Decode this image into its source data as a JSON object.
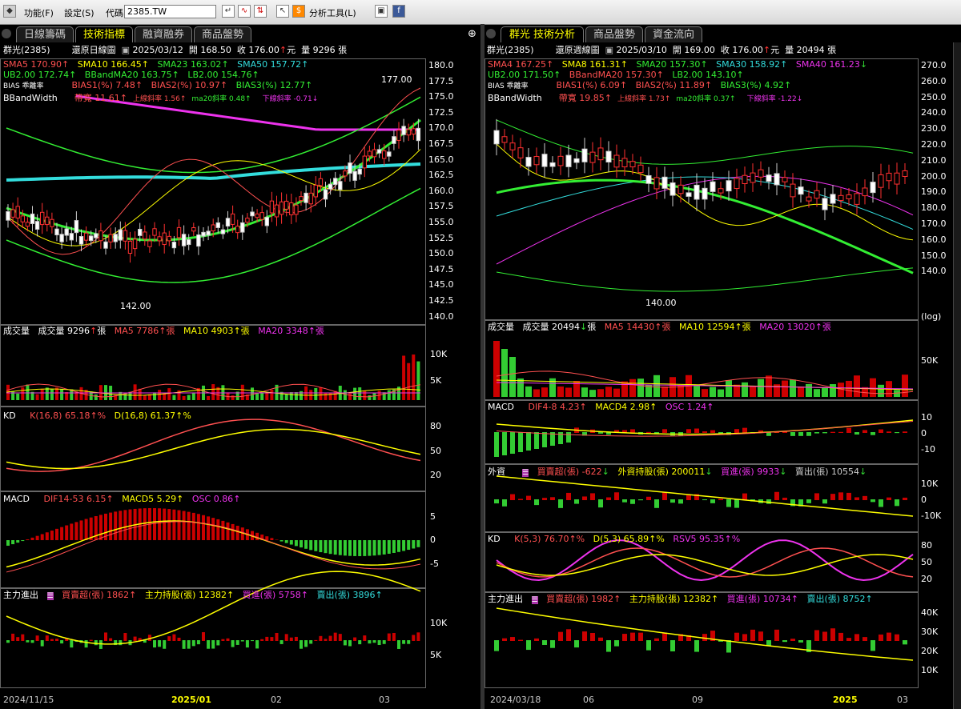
{
  "toolbar": {
    "function": "功能(F)",
    "settings": "設定(S)",
    "code_label": "代碼",
    "code_value": "2385.TW",
    "analysis": "分析工具(L)"
  },
  "left": {
    "tabs": [
      "日線籌碼",
      "技術指標",
      "融資融券",
      "商品盤勢"
    ],
    "name": "群光(2385)",
    "chart_type": "還原日線圖",
    "date": "2025/03/12",
    "open": "開 168.50",
    "close_lbl": "收",
    "close": "176.00",
    "unit": "元",
    "vol_lbl": "量",
    "vol": "9296 張",
    "sma": [
      {
        "t": "SMA5",
        "v": "170.90",
        "c": "#ff5050"
      },
      {
        "t": "SMA10",
        "v": "166.45",
        "c": "#ffff00"
      },
      {
        "t": "SMA23",
        "v": "163.02",
        "c": "#33ee33"
      },
      {
        "t": "SMA50",
        "v": "157.72",
        "c": "#33dddd"
      }
    ],
    "ub": "UB2.00 172.74",
    "bbma": "BBandMA20 163.75",
    "lb": "LB2.00 154.76",
    "bias_lbl": "BIAS 乖離率",
    "bias": [
      "BIAS1(%) 7.48",
      "BIAS2(%) 10.97",
      "BIAS3(%) 12.77"
    ],
    "bbw_lbl": "BBandWidth",
    "bbw": [
      "帶寬 11.61",
      "上線斜率 1.56",
      "ma20斜率 0.48",
      "下線斜率 -0.71"
    ],
    "price_axis": [
      "180.0",
      "177.5",
      "175.0",
      "172.5",
      "170.0",
      "167.5",
      "165.0",
      "162.5",
      "160.0",
      "157.5",
      "155.0",
      "152.5",
      "150.0",
      "147.5",
      "145.0",
      "142.5",
      "140.0"
    ],
    "hi": "177.00",
    "lo": "142.00",
    "vol_panel": {
      "t1": "成交量",
      "t2": "成交量",
      "v": "9296",
      "unit": "張",
      "ma5": "MA5 7786",
      "ma10": "MA10 4903",
      "ma20": "MA20 3348",
      "axis": [
        "10K",
        "5K"
      ]
    },
    "kd": {
      "t": "KD",
      "k": "K(16,8) 65.18",
      "d": "D(16,8) 61.37",
      "pct": "%",
      "axis": [
        "80",
        "50",
        "20"
      ]
    },
    "macd": {
      "t": "MACD",
      "dif": "DIF14-53 6.15",
      "macd": "MACD5 5.29",
      "osc": "OSC 0.86",
      "axis": [
        "5",
        "0",
        "-5"
      ]
    },
    "main": {
      "t": "主力進出",
      "buy_over": "買賣超(張) 1862",
      "hold": "主力持股(張) 12382",
      "buy": "買進(張) 5758",
      "sell": "賣出(張) 3896",
      "axis": [
        "10K",
        "5K"
      ]
    },
    "xaxis": [
      "2024/11/15",
      "2025/01",
      "02",
      "03"
    ]
  },
  "right": {
    "tabs": [
      "群光 技術分析",
      "商品盤勢",
      "資金流向"
    ],
    "name": "群光(2385)",
    "chart_type": "還原週線圖",
    "date": "2025/03/10",
    "open": "開 169.00",
    "close_lbl": "收",
    "close": "176.00",
    "unit": "元",
    "vol_lbl": "量",
    "vol": "20494 張",
    "sma": [
      {
        "t": "SMA4",
        "v": "167.25",
        "c": "#ff5050"
      },
      {
        "t": "SMA8",
        "v": "161.31",
        "c": "#ffff00"
      },
      {
        "t": "SMA20",
        "v": "157.30",
        "c": "#33ee33"
      },
      {
        "t": "SMA30",
        "v": "158.92",
        "c": "#33dddd"
      },
      {
        "t": "SMA40",
        "v": "161.23",
        "c": "#ee33ee"
      }
    ],
    "ub": "UB2.00 171.50",
    "bbma": "BBandMA20 157.30",
    "lb": "LB2.00 143.10",
    "bias_lbl": "BIAS 乖離率",
    "bias": [
      "BIAS1(%) 6.09",
      "BIAS2(%) 11.89",
      "BIAS3(%) 4.92"
    ],
    "bbw_lbl": "BBandWidth",
    "bbw": [
      "帶寬 19.85",
      "上線斜率 1.73",
      "ma20斜率 0.37",
      "下線斜率 -1.22"
    ],
    "price_axis": [
      "270.0",
      "260.0",
      "250.0",
      "240.0",
      "230.0",
      "220.0",
      "210.0",
      "200.0",
      "190.0",
      "180.0",
      "170.0",
      "160.0",
      "150.0",
      "140.0"
    ],
    "log": "(log)",
    "lo": "140.00",
    "vol_panel": {
      "t1": "成交量",
      "t2": "成交量",
      "v": "20494",
      "unit": "張",
      "ma5": "MA5 14430",
      "ma10": "MA10 12594",
      "ma20": "MA20 13020",
      "axis": [
        "50K"
      ]
    },
    "macd": {
      "t": "MACD",
      "dif": "DIF4-8 4.23",
      "macd": "MACD4 2.98",
      "osc": "OSC 1.24",
      "axis": [
        "10",
        "0",
        "-10"
      ]
    },
    "foreign": {
      "t": "外資",
      "buy_over": "買賣超(張) -622",
      "hold": "外資持股(張) 200011",
      "buy": "買進(張) 9933",
      "sell": "賣出(張) 10554",
      "axis": [
        "10K",
        "0",
        "-10K"
      ]
    },
    "kd": {
      "t": "KD",
      "k": "K(5,3) 76.70",
      "d": "D(5,3) 65.89",
      "pct": "%",
      "rsv": "RSV5 95.35",
      "axis": [
        "80",
        "50",
        "20"
      ]
    },
    "main": {
      "t": "主力進出",
      "buy_over": "買賣超(張) 1982",
      "hold": "主力持股(張) 12382",
      "buy": "買進(張) 10734",
      "sell": "賣出(張) 8752",
      "axis": [
        "40K",
        "30K",
        "20K",
        "10K"
      ]
    },
    "xaxis": [
      "2024/03/18",
      "06",
      "09",
      "2025",
      "03"
    ]
  }
}
